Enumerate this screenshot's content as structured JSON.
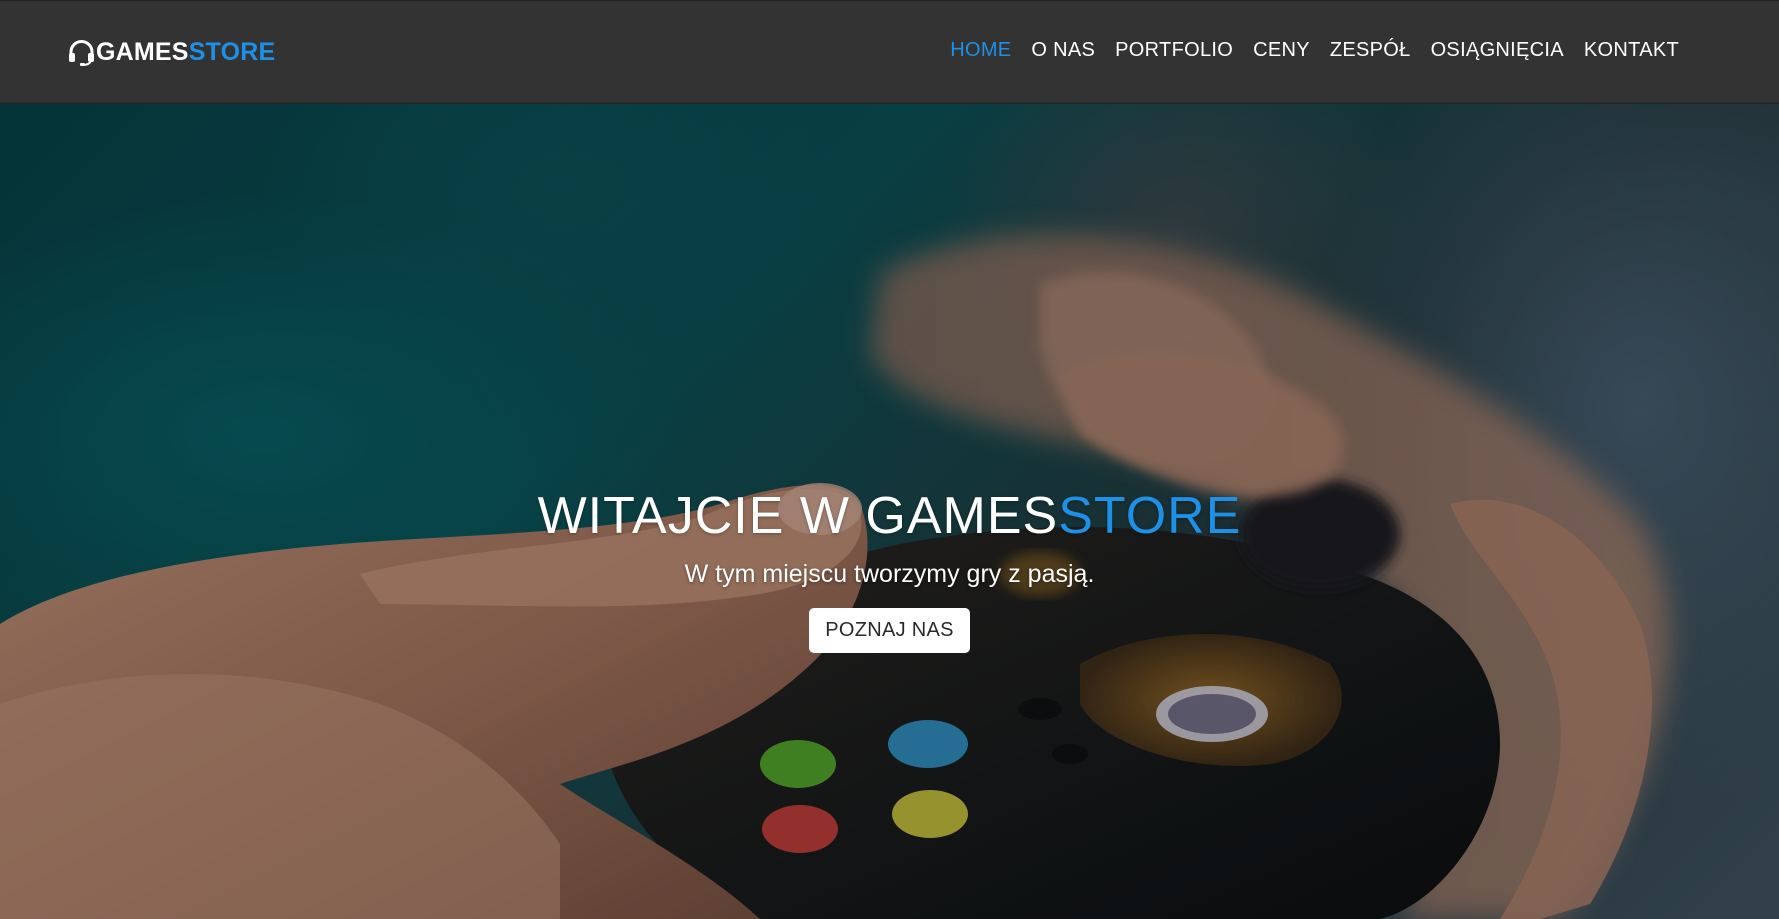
{
  "brand": {
    "icon": "headset-icon",
    "name_part1": "GAMES",
    "name_part2": "STORE",
    "accent_color": "#1e90e6"
  },
  "nav": {
    "items": [
      {
        "label": "HOME",
        "active": true
      },
      {
        "label": "O NAS",
        "active": false
      },
      {
        "label": "PORTFOLIO",
        "active": false
      },
      {
        "label": "CENY",
        "active": false
      },
      {
        "label": "ZESPÓŁ",
        "active": false
      },
      {
        "label": "OSIĄGNIĘCIA",
        "active": false
      },
      {
        "label": "KONTAKT",
        "active": false
      }
    ]
  },
  "hero": {
    "background": "hands-holding-game-controller-photo",
    "title_part1": "WITAJCIE W GAMES",
    "title_part2": "STORE",
    "subtitle": "W tym miejscu tworzymy gry z pasją.",
    "button_label": "POZNAJ NAS"
  },
  "colors": {
    "navbar_bg": "#333333",
    "accent": "#1e90e6",
    "text": "#ffffff"
  }
}
